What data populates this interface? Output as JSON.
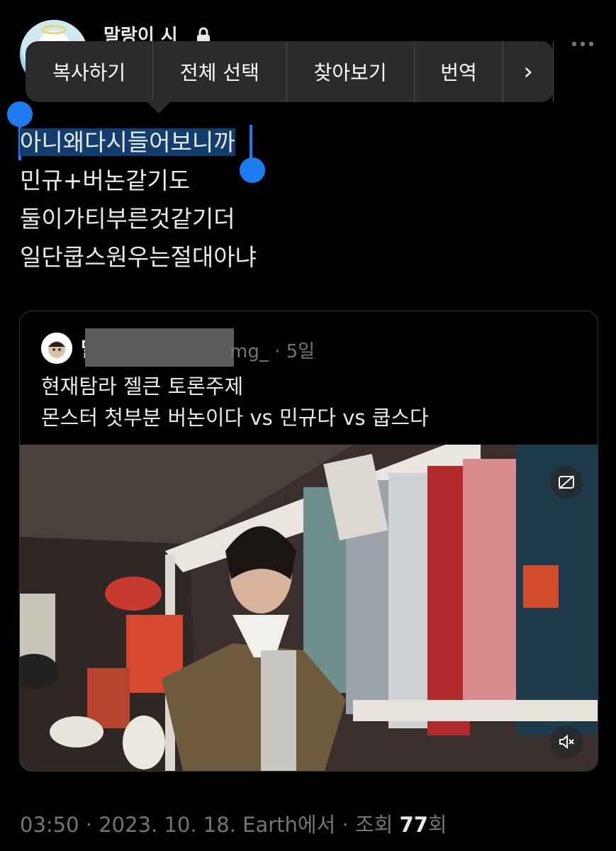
{
  "profile": {
    "display_name": "말랑이 시"
  },
  "context_menu": {
    "items": [
      "복사하기",
      "전체 선택",
      "찾아보기",
      "번역"
    ],
    "more_glyph": "›"
  },
  "tweet": {
    "lines": [
      "아니왜다시들어보니까",
      "민규+버논같기도",
      "둘이가티부른것같기더",
      "일단쿱스원우는절대아냐"
    ]
  },
  "quote": {
    "name_visible": "말",
    "handle_suffix": "mg_",
    "time": "· 5일",
    "lines": [
      "현재탐라 젤큰 토론주제",
      "몬스터 첫부분 버논이다 vs 민규다 vs 쿱스다"
    ]
  },
  "footer": {
    "time": "03:50",
    "date": "2023. 10. 18.",
    "source": "Earth에서",
    "views_label": "조회",
    "views_count": "77",
    "views_suffix": "회"
  },
  "colors": {
    "accent": "#1d7cf2",
    "selection": "#123d6f",
    "secondary_text": "#71767b"
  },
  "icons": [
    "lock-icon",
    "more-icon",
    "chevron-right-icon",
    "captions-off-icon",
    "mute-icon"
  ]
}
